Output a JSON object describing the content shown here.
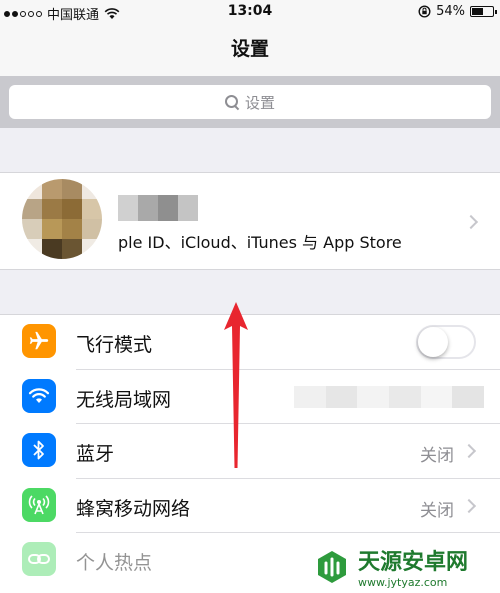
{
  "status_bar": {
    "carrier": "中国联通",
    "time": "13:04",
    "battery": "54%"
  },
  "nav": {
    "title": "设置"
  },
  "search": {
    "placeholder": "设置"
  },
  "profile": {
    "subtitle": "ple ID、iCloud、iTunes 与 App Store"
  },
  "settings": [
    {
      "label": "飞行模式",
      "icon": "airplane-icon",
      "color": "#ff9500",
      "control": "toggle",
      "on": false
    },
    {
      "label": "无线局域网",
      "icon": "wifi-icon",
      "color": "#007aff",
      "control": "blurred-value"
    },
    {
      "label": "蓝牙",
      "icon": "bluetooth-icon",
      "color": "#007aff",
      "value": "关闭"
    },
    {
      "label": "蜂窝移动网络",
      "icon": "cellular-icon",
      "color": "#4cd964",
      "value": "关闭"
    },
    {
      "label": "个人热点",
      "icon": "hotspot-icon",
      "color": "#4cd964",
      "disabled": true
    }
  ],
  "watermark": {
    "name": "天源安卓网",
    "url": "www.jytyaz.com"
  }
}
